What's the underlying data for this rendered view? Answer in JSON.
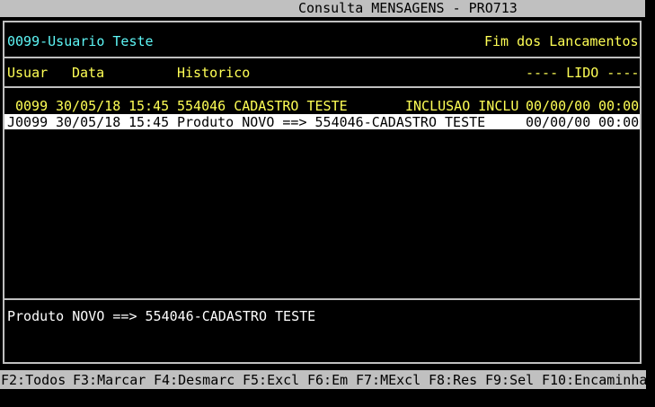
{
  "window": {
    "title": "Consulta MENSAGENS - PRO713"
  },
  "header": {
    "user": "0099-Usuario Teste",
    "status": "Fim dos Lancamentos"
  },
  "columns": {
    "user": "Usuar",
    "date": "Data",
    "history": "Historico",
    "read": "---- LIDO ----"
  },
  "rows": [
    {
      "user": "0099",
      "date": "30/05/18",
      "time": "15:45",
      "history": "554046 CADASTRO TESTE",
      "action": "INCLUSAO INCLU",
      "read_date": "00/00/00",
      "read_time": "00:00"
    },
    {
      "user": "J0099",
      "date": "30/05/18",
      "time": "15:45",
      "history": "Produto NOVO ==> 554046-CADASTRO TESTE",
      "action": "",
      "read_date": "00/00/00",
      "read_time": "00:00"
    }
  ],
  "detail": {
    "text": "Produto NOVO ==> 554046-CADASTRO TESTE"
  },
  "function_keys": [
    "F2:Todos",
    "F3:Marcar",
    "F4:Desmarc",
    "F5:Excl",
    "F6:Em",
    "F7:MExcl",
    "F8:Res",
    "F9:Sel",
    "F10:Encaminha"
  ],
  "colors": {
    "cyan": "#5ef6f6",
    "yellow": "#ffff55",
    "white": "#ffffff",
    "gray": "#c0c0c0",
    "black": "#000000"
  }
}
